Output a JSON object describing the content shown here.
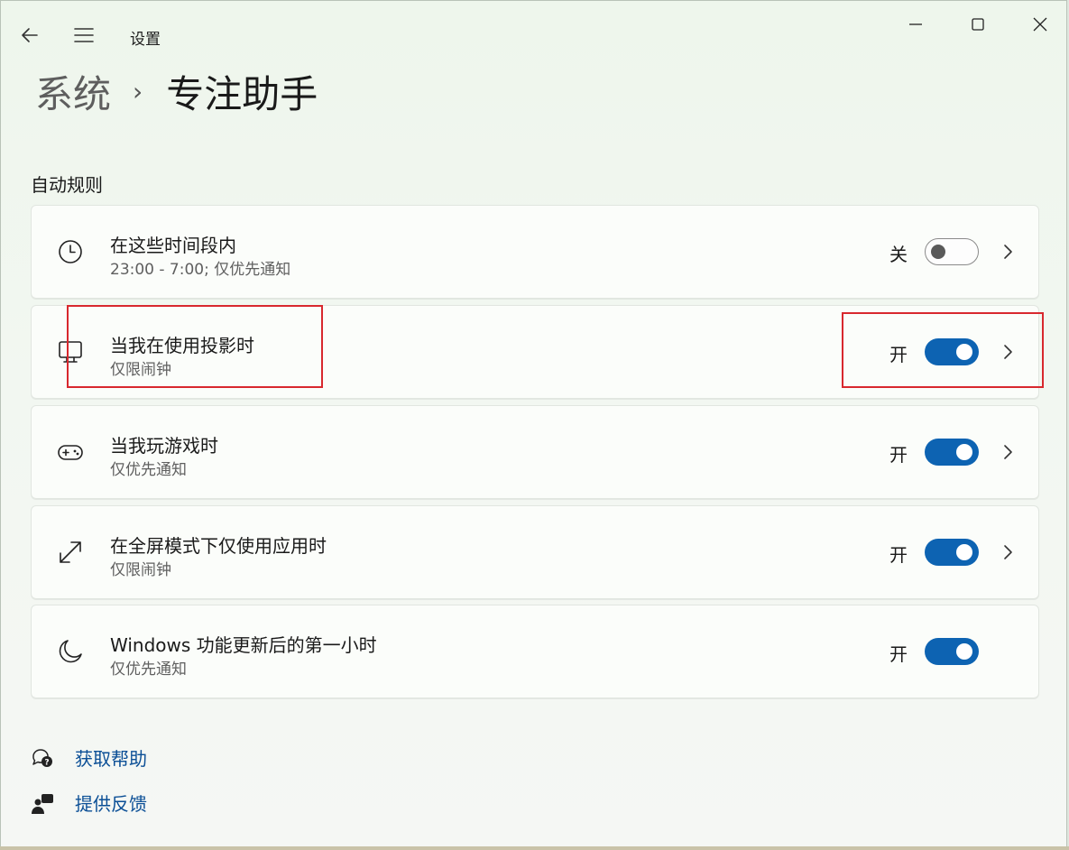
{
  "window": {
    "title": "设置",
    "controls": {
      "back_icon": "back-arrow-icon",
      "menu_icon": "hamburger-menu-icon",
      "minimize_icon": "minimize-icon",
      "maximize_icon": "maximize-icon",
      "close_icon": "close-icon"
    }
  },
  "breadcrumb": {
    "parent": "系统",
    "separator": "›",
    "current": "专注助手"
  },
  "section": {
    "title": "自动规则"
  },
  "rules": [
    {
      "name": "在这些时间段内",
      "description": "23:00 - 7:00; 仅优先通知",
      "state_label": "关",
      "on": false,
      "has_chevron": true,
      "icon": "clock-icon"
    },
    {
      "name": "当我在使用投影时",
      "description": "仅限闹钟",
      "state_label": "开",
      "on": true,
      "has_chevron": true,
      "icon": "monitor-icon"
    },
    {
      "name": "当我玩游戏时",
      "description": "仅优先通知",
      "state_label": "开",
      "on": true,
      "has_chevron": true,
      "icon": "gamepad-icon"
    },
    {
      "name": "在全屏模式下仅使用应用时",
      "description": "仅限闹钟",
      "state_label": "开",
      "on": true,
      "has_chevron": true,
      "icon": "fullscreen-expand-icon"
    },
    {
      "name": "Windows 功能更新后的第一小时",
      "description": "仅优先通知",
      "state_label": "开",
      "on": true,
      "has_chevron": false,
      "icon": "moon-icon"
    }
  ],
  "links": {
    "help": "获取帮助",
    "feedback": "提供反馈"
  },
  "colors": {
    "accent": "#0d63b2",
    "link": "#0b4f96",
    "annotation": "#d8282e"
  }
}
